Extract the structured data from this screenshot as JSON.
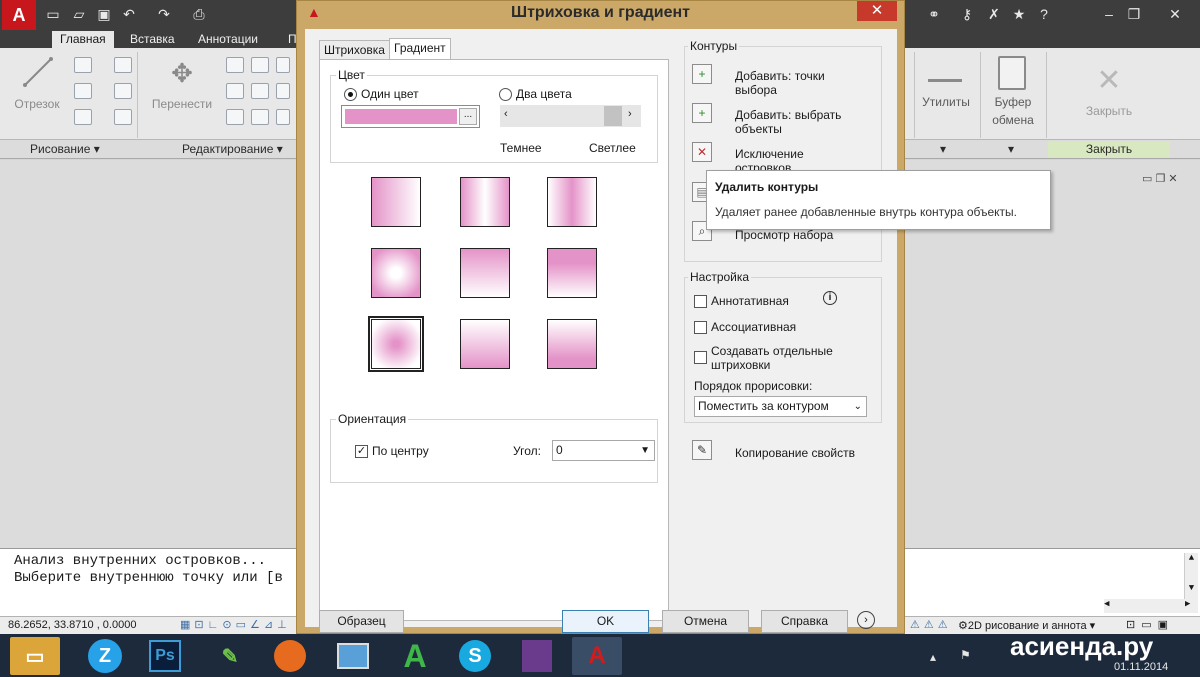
{
  "colors": {
    "dialog_frame": "#cba867",
    "gradient_pink": "#e493c8",
    "autocad_red": "#c8161d",
    "taskbar": "#1d2a3c"
  },
  "ribbon": {
    "tabs": [
      "Главная",
      "Вставка",
      "Аннотации",
      "П"
    ],
    "buttons": {
      "line": "Отрезок",
      "move": "Перенести",
      "utilities": "Утилиты",
      "clipboard_line1": "Буфер",
      "clipboard_line2": "обмена",
      "close": "Закрыть"
    },
    "panels": {
      "draw": "Рисование",
      "modify": "Редактирование",
      "close": "Закрыть"
    }
  },
  "dialog": {
    "title": "Штриховка и градиент",
    "tabs": [
      "Штриховка",
      "Градиент"
    ],
    "color_group": {
      "title": "Цвет",
      "one_color": "Один цвет",
      "two_colors": "Два цвета",
      "browse": "...",
      "darker": "Темнее",
      "lighter": "Светлее",
      "selected": "one_color"
    },
    "orientation": {
      "title": "Ориентация",
      "centered_label": "По центру",
      "centered_checked": true,
      "angle_label": "Угол:",
      "angle_value": "0"
    },
    "boundaries": {
      "title": "Контуры",
      "add_pick_line1": "Добавить: точки",
      "add_pick_line2": "выбора",
      "add_select_line1": "Добавить: выбрать",
      "add_select_line2": "объекты",
      "remove_islands_line1": "Исключение",
      "remove_islands_line2": "островков",
      "view_selection": "Просмотр набора"
    },
    "options": {
      "title": "Настройка",
      "annotative": "Аннотативная",
      "associative": "Ассоциативная",
      "separate_line1": "Создавать отдельные",
      "separate_line2": "штриховки",
      "draw_order_label": "Порядок прорисовки:",
      "draw_order_value": "Поместить за контуром"
    },
    "inherit": "Копирование свойств",
    "buttons": {
      "preview": "Образец",
      "ok": "OK",
      "cancel": "Отмена",
      "help": "Справка"
    }
  },
  "tooltip": {
    "title": "Удалить контуры",
    "text": "Удаляет ранее добавленные внутрь контура объекты."
  },
  "command_line": {
    "line1": "Анализ внутренних островков...",
    "line2": "Выберите внутреннюю точку или [в"
  },
  "status": {
    "coords": "86.2652,  33.8710 , 0.0000",
    "workspace": "2D рисование и аннота"
  },
  "taskbar": {
    "watermark": "асиенда.ру",
    "date": "01.11.2014"
  }
}
